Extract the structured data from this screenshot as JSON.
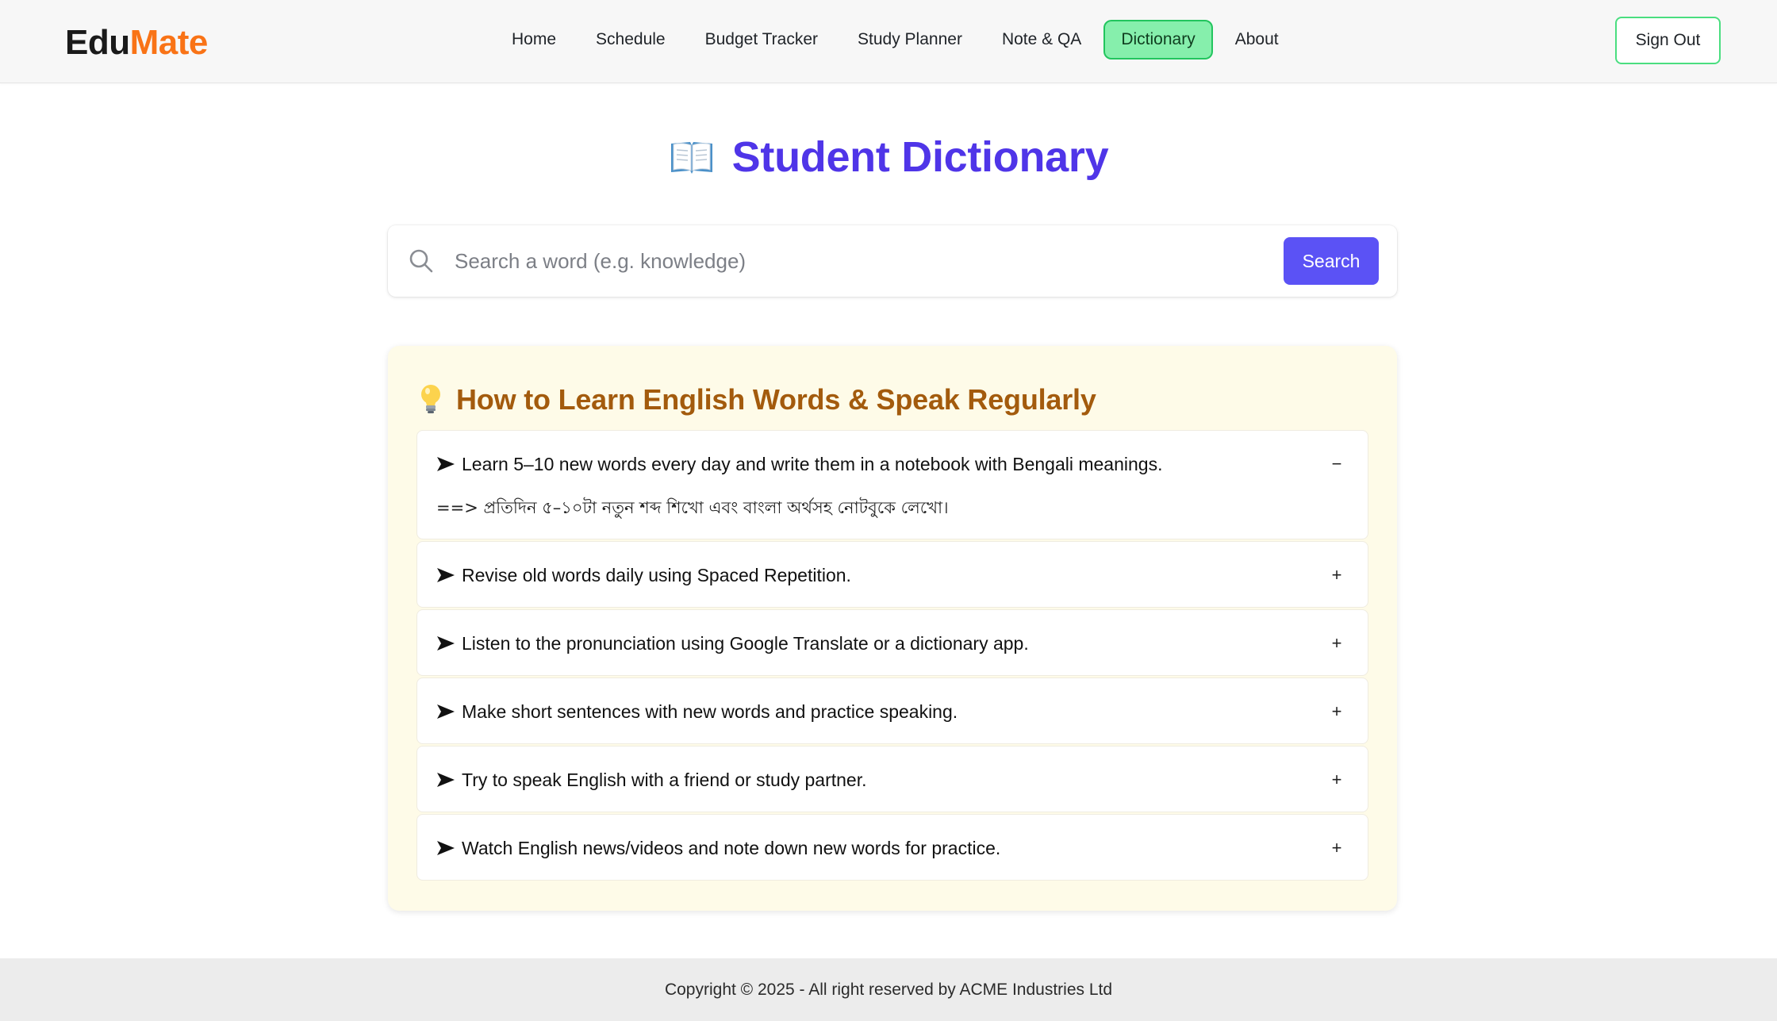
{
  "navbar": {
    "brand_part1": "Edu",
    "brand_part2": "Mate",
    "links": [
      {
        "label": "Home",
        "active": false
      },
      {
        "label": "Schedule",
        "active": false
      },
      {
        "label": "Budget Tracker",
        "active": false
      },
      {
        "label": "Study Planner",
        "active": false
      },
      {
        "label": "Note & QA",
        "active": false
      },
      {
        "label": "Dictionary",
        "active": true
      },
      {
        "label": "About",
        "active": false
      }
    ],
    "signout_label": "Sign Out"
  },
  "page": {
    "title": "Student Dictionary",
    "title_icon": "open-book-icon"
  },
  "search": {
    "value": "",
    "placeholder": "Search a word (e.g. knowledge)",
    "button_label": "Search",
    "icon": "search-icon"
  },
  "tips": {
    "title": "How to Learn English Words & Speak Regularly",
    "icon": "light-bulb-icon",
    "items": [
      {
        "question": "Learn 5–10 new words every day and write them in a notebook with Bengali meanings.",
        "answer": "==> প্রতিদিন ৫–১০টা নতুন শব্দ শিখো এবং বাংলা অর্থসহ নোটবুকে লেখো।",
        "expanded": true,
        "toggle": "−"
      },
      {
        "question": "Revise old words daily using Spaced Repetition.",
        "expanded": false,
        "toggle": "+"
      },
      {
        "question": "Listen to the pronunciation using Google Translate or a dictionary app.",
        "expanded": false,
        "toggle": "+"
      },
      {
        "question": "Make short sentences with new words and practice speaking.",
        "expanded": false,
        "toggle": "+"
      },
      {
        "question": "Try to speak English with a friend or study partner.",
        "expanded": false,
        "toggle": "+"
      },
      {
        "question": "Watch English news/videos and note down new words for practice.",
        "expanded": false,
        "toggle": "+"
      }
    ]
  },
  "footer": {
    "text": "Copyright © 2025 - All right reserved by ACME Industries Ltd"
  },
  "colors": {
    "brand_dark": "#1a1a1a",
    "brand_accent": "#f97316",
    "nav_active_bg": "#86efac",
    "title": "#4f35e8",
    "search_button": "#5b52f5",
    "tips_bg": "#fefbe8",
    "tips_title": "#a35b0d",
    "footer_bg": "#ececec"
  }
}
